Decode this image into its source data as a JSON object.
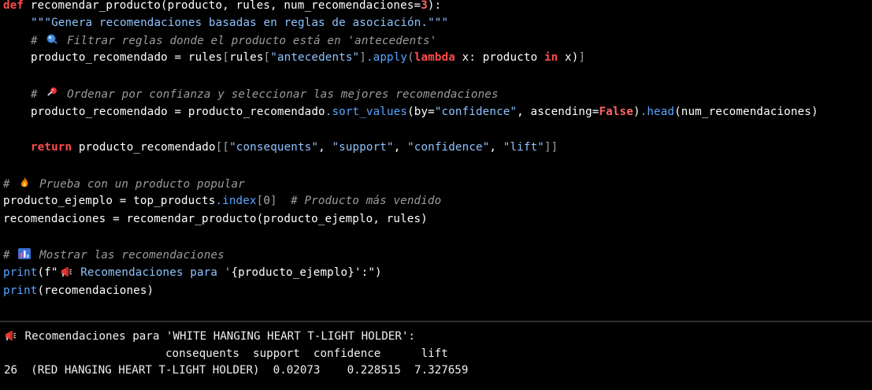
{
  "code": {
    "l1_def": "def",
    "l1_fn": "recomendar_producto",
    "l1_params_a": "(producto, rules, num_recomendaciones=",
    "l1_num": "3",
    "l1_params_b": "):",
    "l2_doc": "\"\"\"Genera recomendaciones basadas en reglas de asociación.\"\"\"",
    "l3_hash": "#",
    "l3_comment": " Filtrar reglas donde el producto está en 'antecedents'",
    "l4_a": "producto_recomendado = rules",
    "l4_b": "[",
    "l4_c": "rules",
    "l4_d": "[",
    "l4_str": "\"antecedents\"",
    "l4_e": "]",
    "l4_f": ".apply",
    "l4_g": "(",
    "l4_lambda": "lambda",
    "l4_h": " x: producto ",
    "l4_in": "in",
    "l4_i": " x)",
    "l4_j": "]",
    "l6_hash": "#",
    "l6_comment": " Ordenar por confianza y seleccionar las mejores recomendaciones",
    "l7_a": "producto_recomendado = producto_recomendado",
    "l7_b": ".sort_values",
    "l7_c": "(by=",
    "l7_str": "\"confidence\"",
    "l7_d": ", ascending=",
    "l7_false": "False",
    "l7_e": ")",
    "l7_f": ".head",
    "l7_g": "(num_recomendaciones)",
    "l9_return": "return",
    "l9_a": " producto_recomendado",
    "l9_b": "[[",
    "l9_s1": "\"consequents\"",
    "l9_c1": ", ",
    "l9_s2": "\"support\"",
    "l9_c2": ", ",
    "l9_s3": "\"confidence\"",
    "l9_c3": ", ",
    "l9_s4": "\"lift\"",
    "l9_d": "]]",
    "l11_hash": "#",
    "l11_comment": " Prueba con un producto popular",
    "l12_a": "producto_ejemplo = top_products",
    "l12_b": ".index",
    "l12_c": "[",
    "l12_num": "0",
    "l12_d": "]",
    "l12_comment": "  # Producto más vendido",
    "l13": "recomendaciones = recomendar_producto(producto_ejemplo, rules)",
    "l15_hash": "#",
    "l15_comment": " Mostrar las recomendaciones",
    "l16_print": "print",
    "l16_a": "(f\"",
    "l16_str": " Recomendaciones para '",
    "l16_brace_open": "{",
    "l16_var": "producto_ejemplo",
    "l16_brace_close": "}",
    "l16_b": "':\")",
    "l17_print": "print",
    "l17_a": "(recomendaciones)"
  },
  "icons": {
    "magnifier": "magnifier-icon",
    "pin": "pushpin-icon",
    "fire": "fire-icon",
    "chart": "bar-chart-icon",
    "megaphone": "megaphone-icon"
  },
  "output": {
    "header": " Recomendaciones para 'WHITE HANGING HEART T-LIGHT HOLDER':",
    "columns_line": "                        consequents  support  confidence      lift",
    "row_line": "26  (RED HANGING HEART T-LIGHT HOLDER)  0.02073    0.228515  7.327659"
  }
}
